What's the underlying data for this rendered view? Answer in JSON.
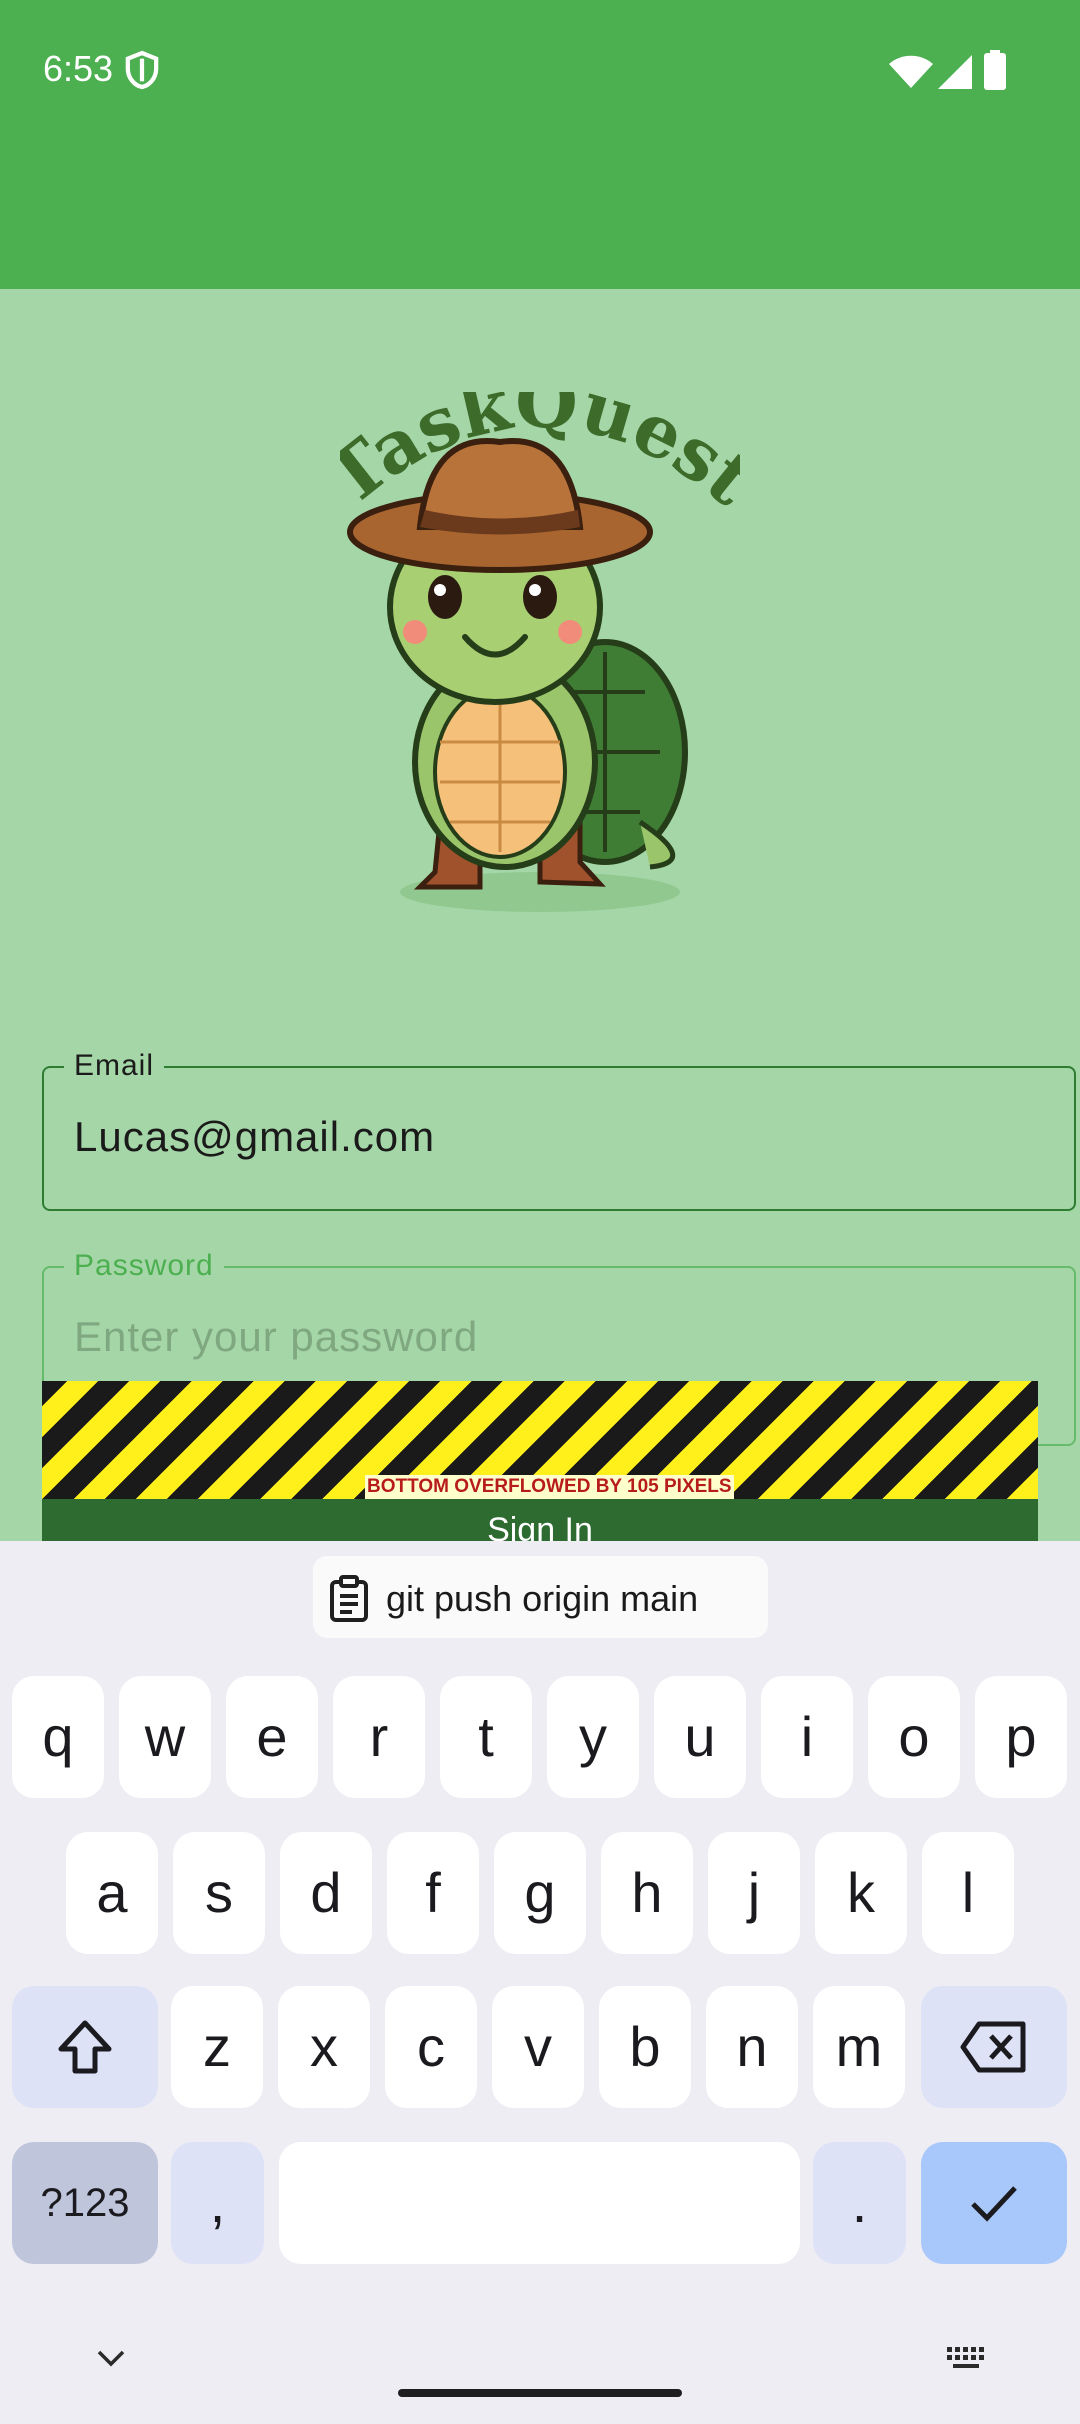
{
  "status_bar": {
    "time": "6:53"
  },
  "logo": {
    "text": "TaskQuest"
  },
  "form": {
    "email": {
      "label": "Email",
      "value": "Lucas@gmail.com"
    },
    "password": {
      "label": "Password",
      "placeholder": "Enter your password"
    },
    "overflow_warning": "BOTTOM OVERFLOWED BY 105 PIXELS",
    "sign_in_label": "Sign In"
  },
  "keyboard": {
    "suggestion": "git push origin main",
    "rows": [
      [
        "q",
        "w",
        "e",
        "r",
        "t",
        "y",
        "u",
        "i",
        "o",
        "p"
      ],
      [
        "a",
        "s",
        "d",
        "f",
        "g",
        "h",
        "j",
        "k",
        "l"
      ],
      [
        "z",
        "x",
        "c",
        "v",
        "b",
        "n",
        "m"
      ]
    ],
    "symbols_label": "?123",
    "comma": ",",
    "period": "."
  },
  "colors": {
    "app_bar": "#4caf50",
    "background": "#a5d6a7",
    "button": "#2e6b30",
    "enter_key": "#a8c7fa"
  }
}
